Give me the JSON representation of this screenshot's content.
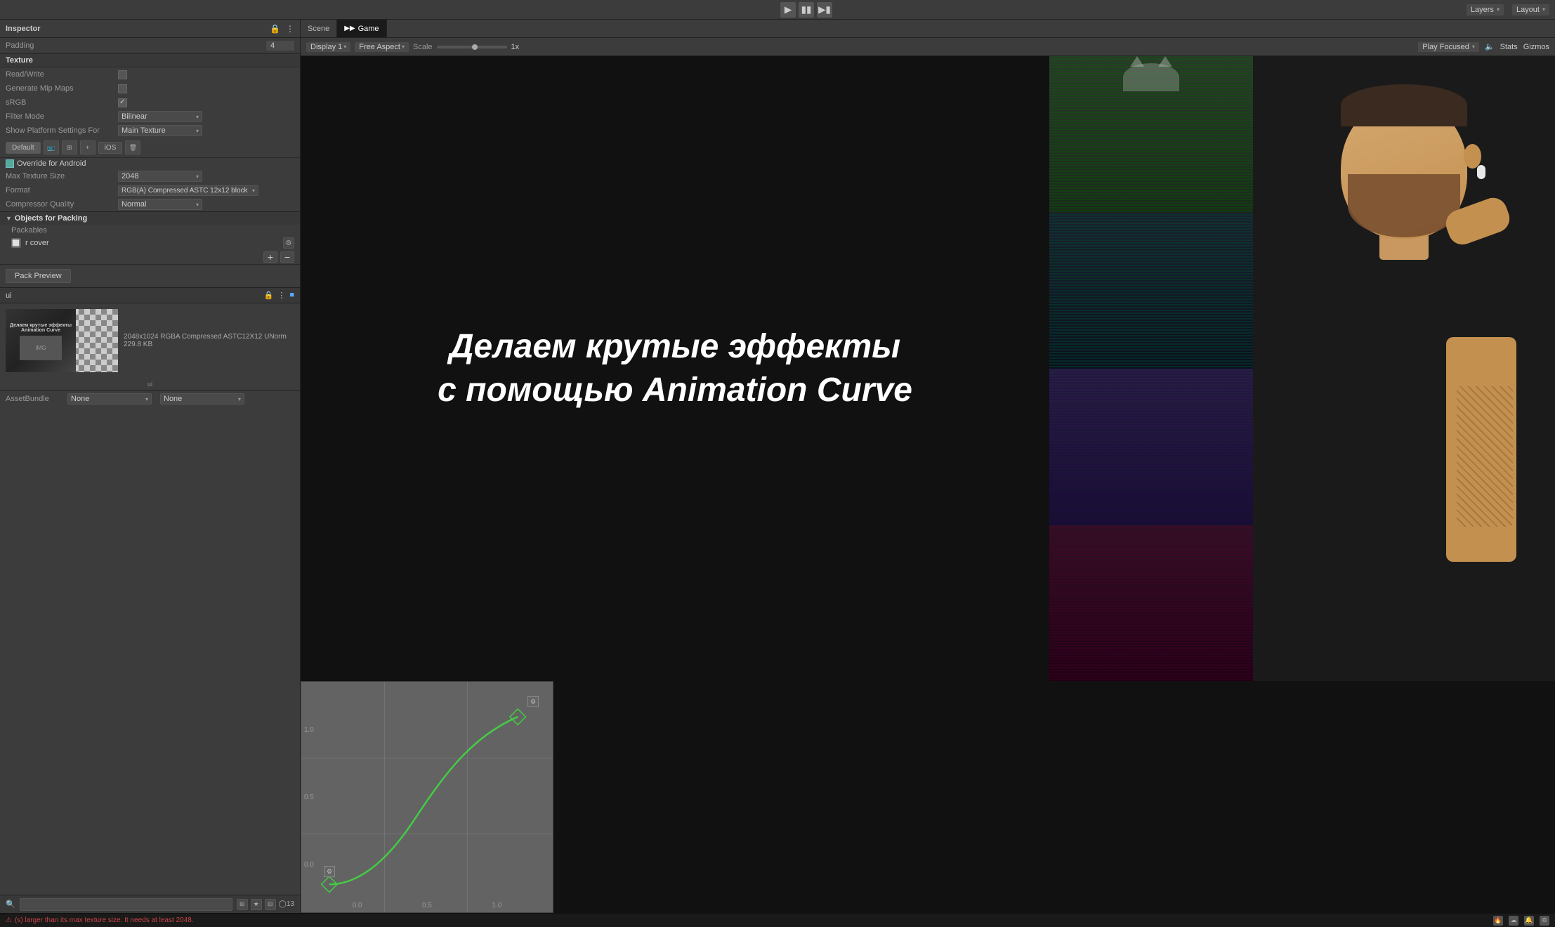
{
  "topBar": {
    "layers_label": "Layers",
    "layout_label": "Layout",
    "chevron": "▾"
  },
  "inspector": {
    "title": "Inspector",
    "padding_label": "Padding",
    "padding_value": "4",
    "texture_section": "Texture",
    "read_write_label": "Read/Write",
    "read_write_checked": false,
    "generate_mip_maps_label": "Generate Mip Maps",
    "generate_mip_maps_checked": false,
    "srgb_label": "sRGB",
    "srgb_checked": true,
    "filter_mode_label": "Filter Mode",
    "filter_mode_value": "Bilinear",
    "show_platform_label": "Show Platform Settings For",
    "show_platform_value": "Main Texture",
    "platform_default": "Default",
    "platform_ios": "iOS",
    "override_label": "Override for Android",
    "override_checked": true,
    "max_texture_size_label": "Max Texture Size",
    "max_texture_size_value": "2048",
    "format_label": "Format",
    "format_value": "RGB(A) Compressed ASTC 12x12 block",
    "compressor_quality_label": "Compressor Quality",
    "compressor_quality_value": "Normal",
    "objects_for_packing": "Objects for Packing",
    "packables_label": "Packables",
    "cover_label": "r cover",
    "pack_preview_btn": "Pack Preview",
    "preview_section_label": "ui",
    "texture_info": "2048x1024 RGBA Compressed ASTC12X12 UNorm  229.8 KB",
    "asset_bundle_label": "AssetBundle",
    "asset_bundle_value": "None",
    "asset_bundle_value2": "None"
  },
  "bottomSearch": {
    "placeholder": "",
    "item_count": "13"
  },
  "gameTabs": {
    "scene_tab": "Scene",
    "game_tab": "Game",
    "display_label": "Display 1",
    "aspect_label": "Free Aspect",
    "scale_label": "Scale",
    "scale_value": "1x",
    "play_focused_label": "Play Focused",
    "stats_label": "Stats",
    "gizmos_label": "Gizmos"
  },
  "gameView": {
    "russian_line1": "Делаем крутые эффекты",
    "russian_line2": "с помощью Animation Curve"
  },
  "animCurve": {
    "label_x1": "0.0",
    "label_x2": "0.5",
    "label_x3": "1.0",
    "label_y1": "1.0",
    "label_y2": "0.5",
    "label_y3": "0.0"
  },
  "statusBar": {
    "error_text": "(s) larger than its max texture size. It needs at least 2048.",
    "warning_icon": "⚠",
    "error_icon": "✕"
  }
}
